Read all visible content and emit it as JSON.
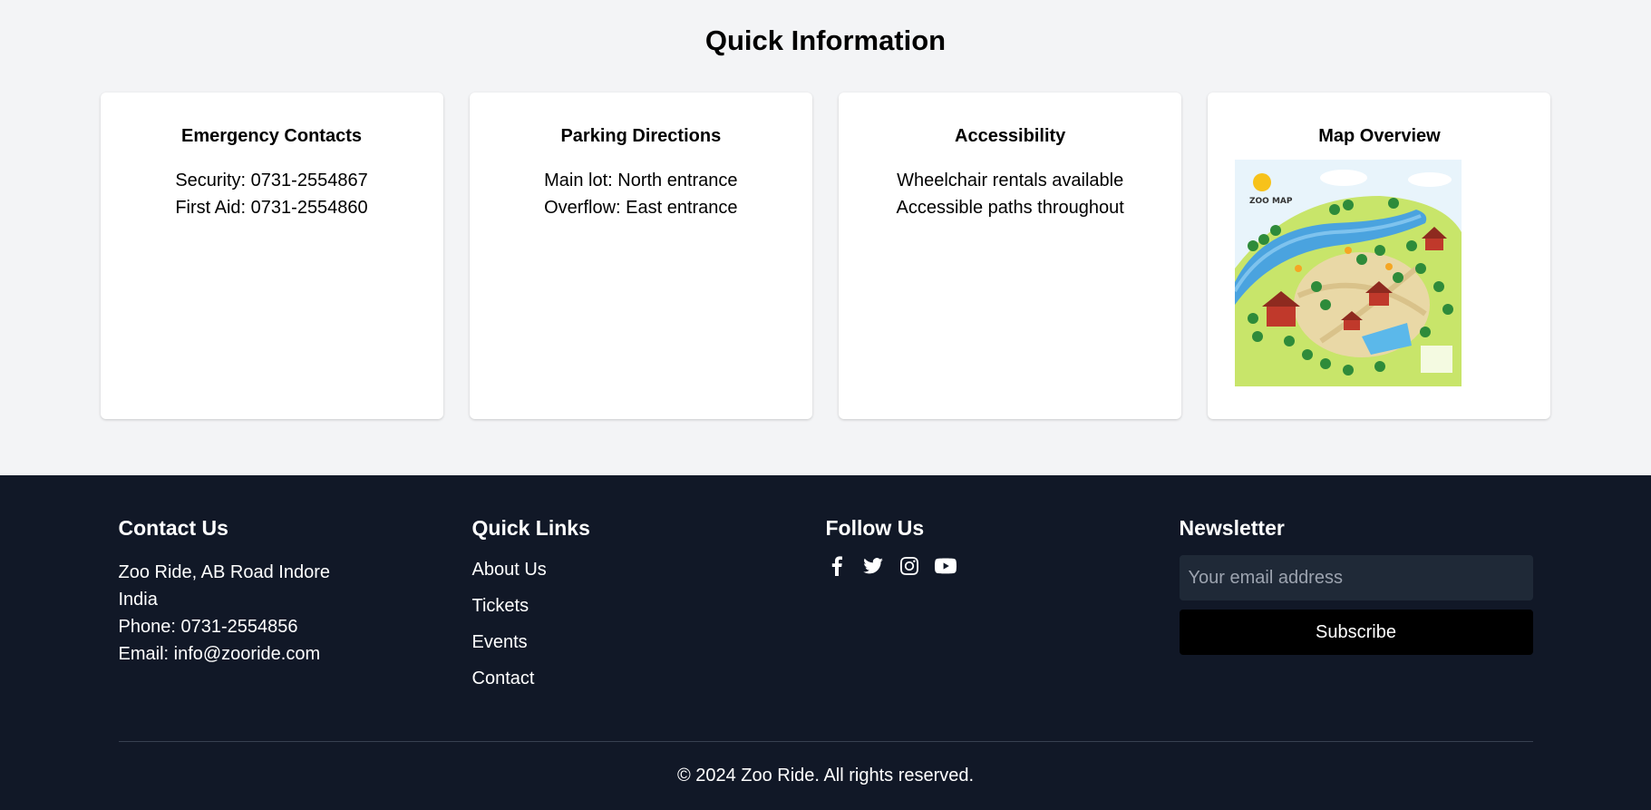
{
  "quick_info": {
    "title": "Quick Information",
    "cards": [
      {
        "title": "Emergency Contacts",
        "lines": [
          "Security: 0731-2554867",
          "First Aid: 0731-2554860"
        ]
      },
      {
        "title": "Parking Directions",
        "lines": [
          "Main lot: North entrance",
          "Overflow: East entrance"
        ]
      },
      {
        "title": "Accessibility",
        "lines": [
          "Wheelchair rentals available",
          "Accessible paths throughout"
        ]
      },
      {
        "title": "Map Overview",
        "map_label": "ZOO MAP"
      }
    ]
  },
  "footer": {
    "contact": {
      "heading": "Contact Us",
      "address": "Zoo Ride, AB Road Indore",
      "country": "India",
      "phone": "Phone: 0731-2554856",
      "email": "Email: info@zooride.com"
    },
    "links": {
      "heading": "Quick Links",
      "items": [
        "About Us",
        "Tickets",
        "Events",
        "Contact"
      ]
    },
    "follow": {
      "heading": "Follow Us",
      "icons": [
        "facebook-icon",
        "twitter-icon",
        "instagram-icon",
        "youtube-icon"
      ]
    },
    "newsletter": {
      "heading": "Newsletter",
      "placeholder": "Your email address",
      "button": "Subscribe"
    },
    "copyright": "© 2024 Zoo Ride. All rights reserved."
  },
  "colors": {
    "page_bg": "#f3f4f6",
    "footer_bg": "#111827",
    "input_bg": "#1f2937",
    "button_bg": "#000000"
  }
}
